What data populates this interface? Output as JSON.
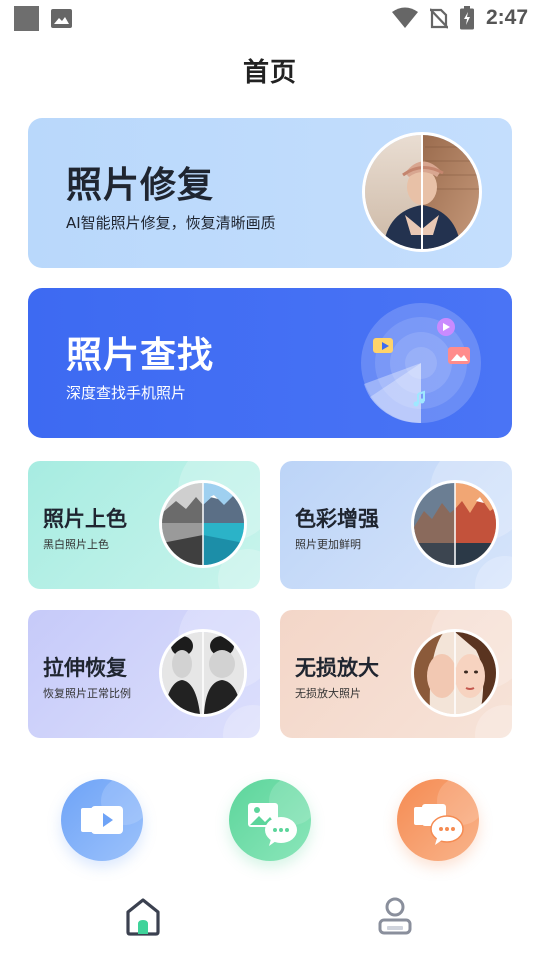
{
  "status_bar": {
    "time": "2:47",
    "icons": [
      "notification-square-icon",
      "image-notification-icon",
      "wifi-icon",
      "no-sim-icon",
      "battery-charging-icon"
    ]
  },
  "header": {
    "title": "首页"
  },
  "cards": {
    "restore": {
      "title": "照片修复",
      "subtitle": "AI智能照片修复，恢复清晰画质"
    },
    "find": {
      "title": "照片查找",
      "subtitle": "深度查找手机照片"
    }
  },
  "tools": [
    {
      "title": "照片上色",
      "subtitle": "黑白照片上色"
    },
    {
      "title": "色彩增强",
      "subtitle": "照片更加鲜明"
    },
    {
      "title": "拉伸恢复",
      "subtitle": "恢复照片正常比例"
    },
    {
      "title": "无损放大",
      "subtitle": "无损放大照片"
    }
  ],
  "quick_actions": [
    "video-recovery-icon",
    "wechat-photo-icon",
    "wechat-video-icon"
  ],
  "bottom_nav": [
    "home-icon",
    "profile-icon"
  ],
  "colors": {
    "restore_card": "#b9d8fb",
    "find_card": "#3d6af2",
    "colorize_card": "#a7ece1",
    "enhance_card": "#bcd4f7",
    "stretch_card": "#c6caf9",
    "zoom_card": "#f3d6c8",
    "home_active": "#3fd39a"
  }
}
